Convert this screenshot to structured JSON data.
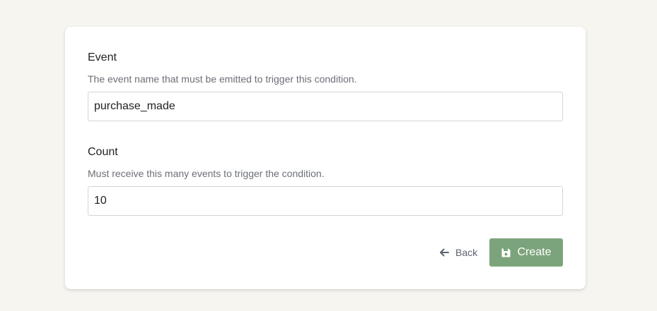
{
  "form": {
    "event": {
      "label": "Event",
      "help": "The event name that must be emitted to trigger this condition.",
      "value": "purchase_made"
    },
    "count": {
      "label": "Count",
      "help": "Must receive this many events to trigger the condition.",
      "value": "10"
    }
  },
  "actions": {
    "back_label": "Back",
    "back_icon": "arrow-left-icon",
    "create_label": "Create",
    "create_icon": "save-icon"
  },
  "colors": {
    "page_background": "#f7f5f0",
    "card_background": "#ffffff",
    "primary_button": "#7ca47c",
    "help_text": "#6b6f76"
  }
}
